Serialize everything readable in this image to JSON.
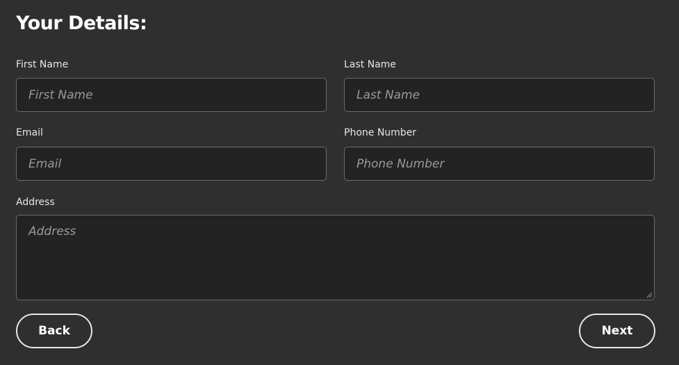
{
  "form": {
    "title": "Your Details:",
    "fields": {
      "first_name": {
        "label": "First Name",
        "placeholder": "First Name",
        "value": ""
      },
      "last_name": {
        "label": "Last Name",
        "placeholder": "Last Name",
        "value": ""
      },
      "email": {
        "label": "Email",
        "placeholder": "Email",
        "value": ""
      },
      "phone": {
        "label": "Phone Number",
        "placeholder": "Phone Number",
        "value": ""
      },
      "address": {
        "label": "Address",
        "placeholder": "Address",
        "value": ""
      }
    },
    "buttons": {
      "back_label": "Back",
      "next_label": "Next"
    }
  },
  "colors": {
    "background": "#2f2f2f",
    "input_background": "#232323",
    "input_border": "#6b6b6b",
    "placeholder_text": "#9a9a9a",
    "button_border": "#e8e8e8",
    "text": "#ffffff"
  },
  "icons": {
    "textarea_resize": "resize-grip-icon"
  }
}
